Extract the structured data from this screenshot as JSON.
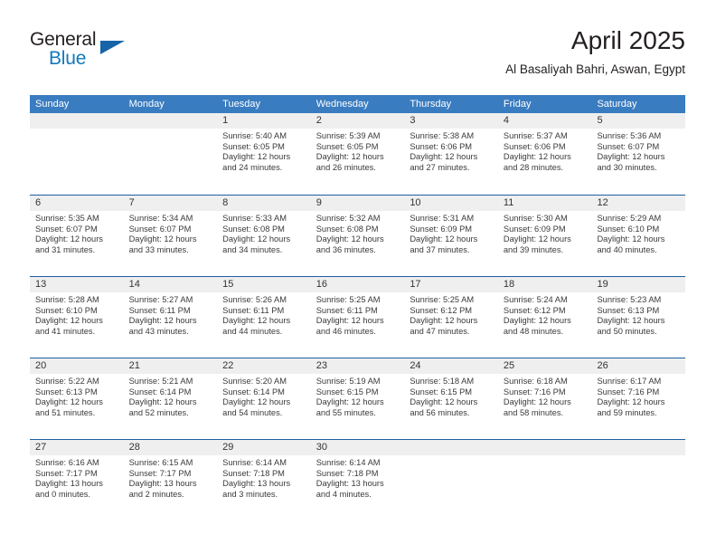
{
  "brand": {
    "name_part1": "General",
    "name_part2": "Blue",
    "logo_icon": "triangle-logo-icon"
  },
  "header": {
    "month_title": "April 2025",
    "location": "Al Basaliyah Bahri, Aswan, Egypt"
  },
  "calendar": {
    "weekday_headers": [
      "Sunday",
      "Monday",
      "Tuesday",
      "Wednesday",
      "Thursday",
      "Friday",
      "Saturday"
    ],
    "colors": {
      "header_blue": "#3a7cc0",
      "row_divider_blue": "#1f5fa0",
      "daynum_band": "#efefef",
      "brand_blue": "#1278be",
      "text": "#231f20"
    },
    "weeks": [
      [
        {
          "day": "",
          "lines": []
        },
        {
          "day": "",
          "lines": []
        },
        {
          "day": "1",
          "lines": [
            "Sunrise: 5:40 AM",
            "Sunset: 6:05 PM",
            "Daylight: 12 hours",
            "and 24 minutes."
          ]
        },
        {
          "day": "2",
          "lines": [
            "Sunrise: 5:39 AM",
            "Sunset: 6:05 PM",
            "Daylight: 12 hours",
            "and 26 minutes."
          ]
        },
        {
          "day": "3",
          "lines": [
            "Sunrise: 5:38 AM",
            "Sunset: 6:06 PM",
            "Daylight: 12 hours",
            "and 27 minutes."
          ]
        },
        {
          "day": "4",
          "lines": [
            "Sunrise: 5:37 AM",
            "Sunset: 6:06 PM",
            "Daylight: 12 hours",
            "and 28 minutes."
          ]
        },
        {
          "day": "5",
          "lines": [
            "Sunrise: 5:36 AM",
            "Sunset: 6:07 PM",
            "Daylight: 12 hours",
            "and 30 minutes."
          ]
        }
      ],
      [
        {
          "day": "6",
          "lines": [
            "Sunrise: 5:35 AM",
            "Sunset: 6:07 PM",
            "Daylight: 12 hours",
            "and 31 minutes."
          ]
        },
        {
          "day": "7",
          "lines": [
            "Sunrise: 5:34 AM",
            "Sunset: 6:07 PM",
            "Daylight: 12 hours",
            "and 33 minutes."
          ]
        },
        {
          "day": "8",
          "lines": [
            "Sunrise: 5:33 AM",
            "Sunset: 6:08 PM",
            "Daylight: 12 hours",
            "and 34 minutes."
          ]
        },
        {
          "day": "9",
          "lines": [
            "Sunrise: 5:32 AM",
            "Sunset: 6:08 PM",
            "Daylight: 12 hours",
            "and 36 minutes."
          ]
        },
        {
          "day": "10",
          "lines": [
            "Sunrise: 5:31 AM",
            "Sunset: 6:09 PM",
            "Daylight: 12 hours",
            "and 37 minutes."
          ]
        },
        {
          "day": "11",
          "lines": [
            "Sunrise: 5:30 AM",
            "Sunset: 6:09 PM",
            "Daylight: 12 hours",
            "and 39 minutes."
          ]
        },
        {
          "day": "12",
          "lines": [
            "Sunrise: 5:29 AM",
            "Sunset: 6:10 PM",
            "Daylight: 12 hours",
            "and 40 minutes."
          ]
        }
      ],
      [
        {
          "day": "13",
          "lines": [
            "Sunrise: 5:28 AM",
            "Sunset: 6:10 PM",
            "Daylight: 12 hours",
            "and 41 minutes."
          ]
        },
        {
          "day": "14",
          "lines": [
            "Sunrise: 5:27 AM",
            "Sunset: 6:11 PM",
            "Daylight: 12 hours",
            "and 43 minutes."
          ]
        },
        {
          "day": "15",
          "lines": [
            "Sunrise: 5:26 AM",
            "Sunset: 6:11 PM",
            "Daylight: 12 hours",
            "and 44 minutes."
          ]
        },
        {
          "day": "16",
          "lines": [
            "Sunrise: 5:25 AM",
            "Sunset: 6:11 PM",
            "Daylight: 12 hours",
            "and 46 minutes."
          ]
        },
        {
          "day": "17",
          "lines": [
            "Sunrise: 5:25 AM",
            "Sunset: 6:12 PM",
            "Daylight: 12 hours",
            "and 47 minutes."
          ]
        },
        {
          "day": "18",
          "lines": [
            "Sunrise: 5:24 AM",
            "Sunset: 6:12 PM",
            "Daylight: 12 hours",
            "and 48 minutes."
          ]
        },
        {
          "day": "19",
          "lines": [
            "Sunrise: 5:23 AM",
            "Sunset: 6:13 PM",
            "Daylight: 12 hours",
            "and 50 minutes."
          ]
        }
      ],
      [
        {
          "day": "20",
          "lines": [
            "Sunrise: 5:22 AM",
            "Sunset: 6:13 PM",
            "Daylight: 12 hours",
            "and 51 minutes."
          ]
        },
        {
          "day": "21",
          "lines": [
            "Sunrise: 5:21 AM",
            "Sunset: 6:14 PM",
            "Daylight: 12 hours",
            "and 52 minutes."
          ]
        },
        {
          "day": "22",
          "lines": [
            "Sunrise: 5:20 AM",
            "Sunset: 6:14 PM",
            "Daylight: 12 hours",
            "and 54 minutes."
          ]
        },
        {
          "day": "23",
          "lines": [
            "Sunrise: 5:19 AM",
            "Sunset: 6:15 PM",
            "Daylight: 12 hours",
            "and 55 minutes."
          ]
        },
        {
          "day": "24",
          "lines": [
            "Sunrise: 5:18 AM",
            "Sunset: 6:15 PM",
            "Daylight: 12 hours",
            "and 56 minutes."
          ]
        },
        {
          "day": "25",
          "lines": [
            "Sunrise: 6:18 AM",
            "Sunset: 7:16 PM",
            "Daylight: 12 hours",
            "and 58 minutes."
          ]
        },
        {
          "day": "26",
          "lines": [
            "Sunrise: 6:17 AM",
            "Sunset: 7:16 PM",
            "Daylight: 12 hours",
            "and 59 minutes."
          ]
        }
      ],
      [
        {
          "day": "27",
          "lines": [
            "Sunrise: 6:16 AM",
            "Sunset: 7:17 PM",
            "Daylight: 13 hours",
            "and 0 minutes."
          ]
        },
        {
          "day": "28",
          "lines": [
            "Sunrise: 6:15 AM",
            "Sunset: 7:17 PM",
            "Daylight: 13 hours",
            "and 2 minutes."
          ]
        },
        {
          "day": "29",
          "lines": [
            "Sunrise: 6:14 AM",
            "Sunset: 7:18 PM",
            "Daylight: 13 hours",
            "and 3 minutes."
          ]
        },
        {
          "day": "30",
          "lines": [
            "Sunrise: 6:14 AM",
            "Sunset: 7:18 PM",
            "Daylight: 13 hours",
            "and 4 minutes."
          ]
        },
        {
          "day": "",
          "lines": []
        },
        {
          "day": "",
          "lines": []
        },
        {
          "day": "",
          "lines": []
        }
      ]
    ]
  }
}
